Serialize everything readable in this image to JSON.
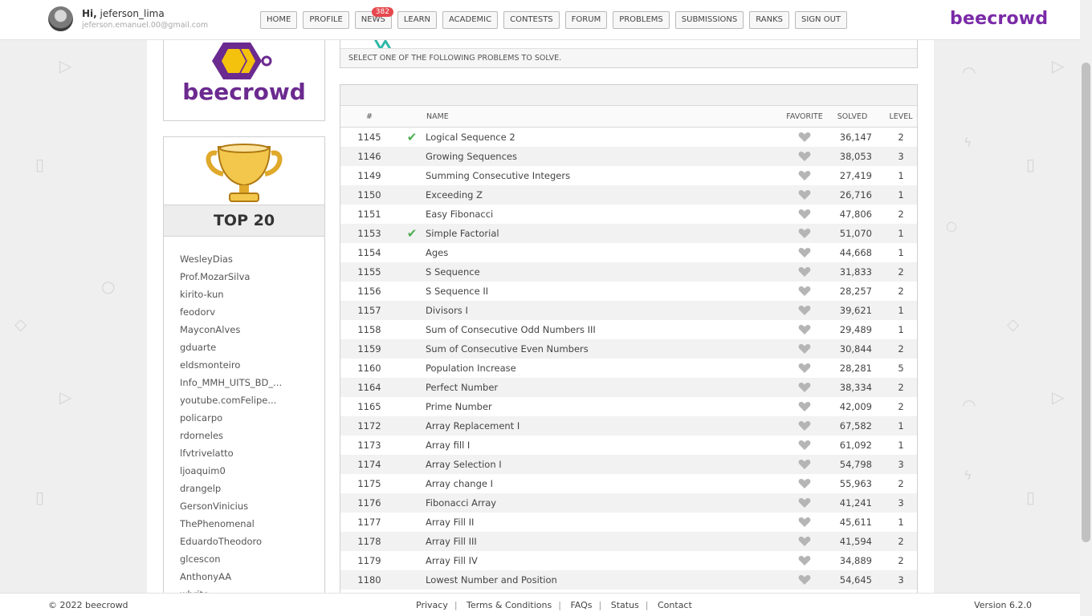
{
  "user": {
    "greeting_prefix": "Hi,",
    "username": "jeferson_lima",
    "email": "jeferson.emanuel.00@gmail.com"
  },
  "nav": {
    "items": [
      "HOME",
      "PROFILE",
      "NEWS",
      "LEARN",
      "ACADEMIC",
      "CONTESTS",
      "FORUM",
      "PROBLEMS",
      "SUBMISSIONS",
      "RANKS",
      "SIGN OUT"
    ],
    "news_badge": "382"
  },
  "brand": "beecrowd",
  "sidebar": {
    "logo_text": "beecrowd",
    "top_title": "TOP 20",
    "top_users": [
      "WesleyDias",
      "Prof.MozarSilva",
      "kirito-kun",
      "feodorv",
      "MayconAlves",
      "gduarte",
      "eldsmonteiro",
      "Info_MMH_UITS_BD_...",
      "youtube.comFelipe...",
      "policarpo",
      "rdorneles",
      "lfvtrivelatto",
      "ljoaquim0",
      "drangelp",
      "GersonVinicius",
      "ThePhenomenal",
      "EduardoTheodoro",
      "glcescon",
      "AnthonyAA",
      "wbrito"
    ]
  },
  "problems": {
    "instruction": "SELECT ONE OF THE FOLLOWING PROBLEMS TO SOLVE.",
    "columns": [
      "#",
      "NAME",
      "FAVORITE",
      "SOLVED",
      "LEVEL"
    ],
    "rows": [
      {
        "id": "1145",
        "solved_by_me": true,
        "name": "Logical Sequence 2",
        "solved": "36,147",
        "level": "2"
      },
      {
        "id": "1146",
        "solved_by_me": false,
        "name": "Growing Sequences",
        "solved": "38,053",
        "level": "3"
      },
      {
        "id": "1149",
        "solved_by_me": false,
        "name": "Summing Consecutive Integers",
        "solved": "27,419",
        "level": "1"
      },
      {
        "id": "1150",
        "solved_by_me": false,
        "name": "Exceeding Z",
        "solved": "26,716",
        "level": "1"
      },
      {
        "id": "1151",
        "solved_by_me": false,
        "name": "Easy Fibonacci",
        "solved": "47,806",
        "level": "2"
      },
      {
        "id": "1153",
        "solved_by_me": true,
        "name": "Simple Factorial",
        "solved": "51,070",
        "level": "1"
      },
      {
        "id": "1154",
        "solved_by_me": false,
        "name": "Ages",
        "solved": "44,668",
        "level": "1"
      },
      {
        "id": "1155",
        "solved_by_me": false,
        "name": "S Sequence",
        "solved": "31,833",
        "level": "2"
      },
      {
        "id": "1156",
        "solved_by_me": false,
        "name": "S Sequence II",
        "solved": "28,257",
        "level": "2"
      },
      {
        "id": "1157",
        "solved_by_me": false,
        "name": "Divisors I",
        "solved": "39,621",
        "level": "1"
      },
      {
        "id": "1158",
        "solved_by_me": false,
        "name": "Sum of Consecutive Odd Numbers III",
        "solved": "29,489",
        "level": "1"
      },
      {
        "id": "1159",
        "solved_by_me": false,
        "name": "Sum of Consecutive Even Numbers",
        "solved": "30,844",
        "level": "2"
      },
      {
        "id": "1160",
        "solved_by_me": false,
        "name": "Population Increase",
        "solved": "28,281",
        "level": "5"
      },
      {
        "id": "1164",
        "solved_by_me": false,
        "name": "Perfect Number",
        "solved": "38,334",
        "level": "2"
      },
      {
        "id": "1165",
        "solved_by_me": false,
        "name": "Prime Number",
        "solved": "42,009",
        "level": "2"
      },
      {
        "id": "1172",
        "solved_by_me": false,
        "name": "Array Replacement I",
        "solved": "67,582",
        "level": "1"
      },
      {
        "id": "1173",
        "solved_by_me": false,
        "name": "Array fill I",
        "solved": "61,092",
        "level": "1"
      },
      {
        "id": "1174",
        "solved_by_me": false,
        "name": "Array Selection I",
        "solved": "54,798",
        "level": "3"
      },
      {
        "id": "1175",
        "solved_by_me": false,
        "name": "Array change I",
        "solved": "55,963",
        "level": "2"
      },
      {
        "id": "1176",
        "solved_by_me": false,
        "name": "Fibonacci Array",
        "solved": "41,241",
        "level": "3"
      },
      {
        "id": "1177",
        "solved_by_me": false,
        "name": "Array Fill II",
        "solved": "45,611",
        "level": "1"
      },
      {
        "id": "1178",
        "solved_by_me": false,
        "name": "Array Fill III",
        "solved": "41,594",
        "level": "2"
      },
      {
        "id": "1179",
        "solved_by_me": false,
        "name": "Array Fill IV",
        "solved": "34,889",
        "level": "2"
      },
      {
        "id": "1180",
        "solved_by_me": false,
        "name": "Lowest Number and Position",
        "solved": "54,645",
        "level": "3"
      }
    ]
  },
  "footer": {
    "copyright": "© 2022 beecrowd",
    "links": [
      "Privacy",
      "Terms & Conditions",
      "FAQs",
      "Status",
      "Contact"
    ],
    "version": "Version 6.2.0"
  },
  "colors": {
    "brand_purple": "#7a2aa7",
    "check_green": "#4caf50",
    "badge_red": "#e5484d"
  },
  "icons": {
    "solved": "check-icon",
    "favorite": "heart-icon",
    "trophy": "trophy-icon"
  }
}
